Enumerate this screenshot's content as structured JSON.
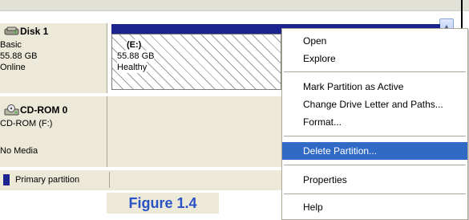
{
  "disks": [
    {
      "title": "Disk 1",
      "icon": "hard-disk-icon",
      "type": "Basic",
      "size": "55.88 GB",
      "status": "Online",
      "partition": {
        "label": "(E:)",
        "size": "55.88 GB",
        "status": "Healthy"
      }
    },
    {
      "title": "CD-ROM 0",
      "icon": "cd-rom-icon",
      "drive": "CD-ROM (F:)",
      "status": "No Media"
    }
  ],
  "legend": {
    "label": "Primary partition",
    "color": "#1a238e"
  },
  "caption": "Figure 1.4",
  "context_menu": {
    "items": [
      {
        "label": "Open"
      },
      {
        "label": "Explore"
      },
      {
        "label": "Mark Partition as Active"
      },
      {
        "label": "Change Drive Letter and Paths..."
      },
      {
        "label": "Format..."
      },
      {
        "label": "Delete Partition...",
        "highlighted": true
      },
      {
        "label": "Properties"
      },
      {
        "label": "Help"
      }
    ]
  },
  "colors": {
    "highlight": "#316ac5",
    "partition_bar": "#1a238e",
    "caption_text": "#2a52c4"
  }
}
